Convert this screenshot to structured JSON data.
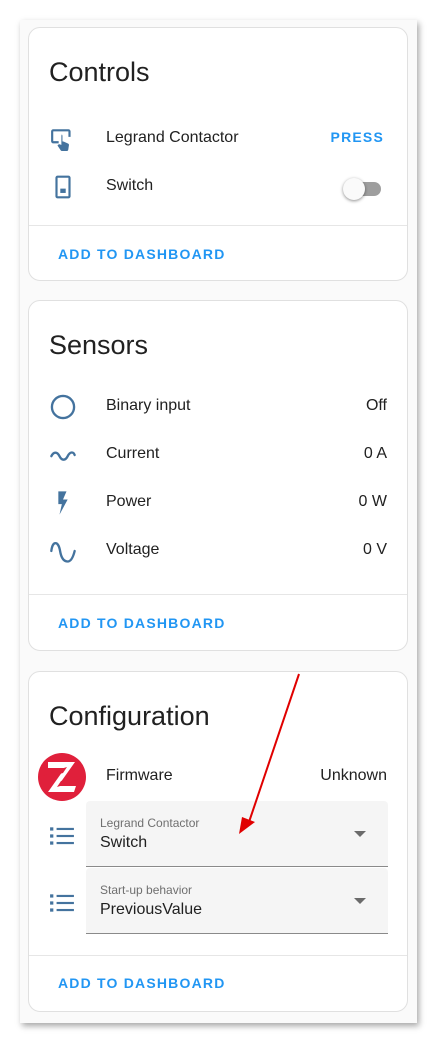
{
  "controls": {
    "title": "Controls",
    "items": [
      {
        "label": "Legrand Contactor",
        "action": "PRESS",
        "icon": "gesture-tap-icon"
      },
      {
        "label": "Switch",
        "icon": "light-switch-icon",
        "toggle_on": false
      }
    ],
    "add_label": "ADD TO DASHBOARD"
  },
  "sensors": {
    "title": "Sensors",
    "items": [
      {
        "label": "Binary input",
        "value": "Off",
        "icon": "circle-outline-icon"
      },
      {
        "label": "Current",
        "value": "0 A",
        "icon": "current-ac-icon"
      },
      {
        "label": "Power",
        "value": "0 W",
        "icon": "flash-icon"
      },
      {
        "label": "Voltage",
        "value": "0 V",
        "icon": "sine-wave-icon"
      }
    ],
    "add_label": "ADD TO DASHBOARD"
  },
  "configuration": {
    "title": "Configuration",
    "firmware": {
      "label": "Firmware",
      "value": "Unknown",
      "icon": "zigbee-logo"
    },
    "selects": [
      {
        "floating_label": "Legrand Contactor",
        "value": "Switch",
        "icon": "format-list-bulleted-icon"
      },
      {
        "floating_label": "Start-up behavior",
        "value": "PreviousValue",
        "icon": "format-list-bulleted-icon"
      }
    ],
    "add_label": "ADD TO DASHBOARD"
  },
  "colors": {
    "accent": "#2196f3",
    "icon": "#44739e",
    "annotation_arrow": "#e00000",
    "zigbee_red": "#e0203b"
  }
}
